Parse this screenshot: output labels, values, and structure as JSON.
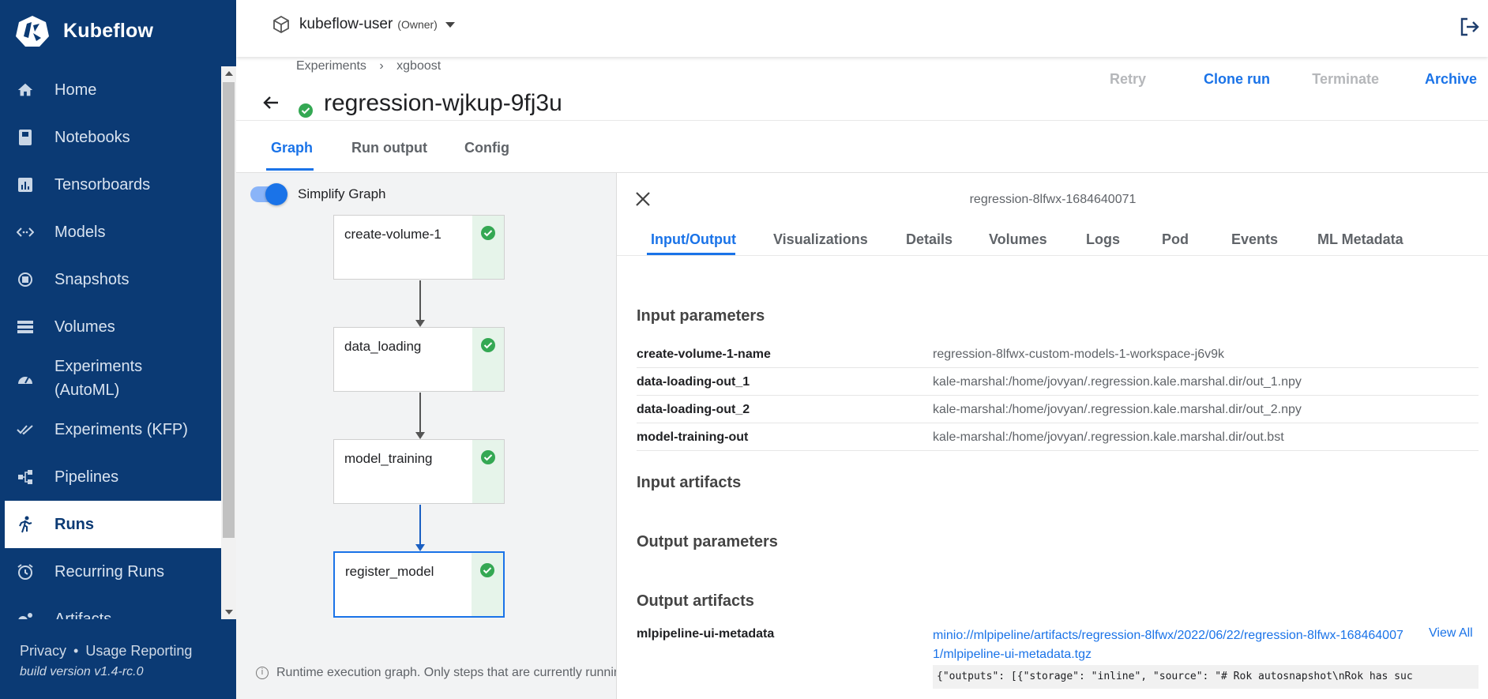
{
  "app": {
    "name": "Kubeflow"
  },
  "sidebar": {
    "items": [
      {
        "label": "Home",
        "icon": "home-icon"
      },
      {
        "label": "Notebooks",
        "icon": "notebook-icon"
      },
      {
        "label": "Tensorboards",
        "icon": "chart-icon"
      },
      {
        "label": "Models",
        "icon": "code-arrows-icon"
      },
      {
        "label": "Snapshots",
        "icon": "snapshot-icon"
      },
      {
        "label": "Volumes",
        "icon": "storage-icon"
      },
      {
        "label": "Experiments",
        "label2": "(AutoML)",
        "icon": "speed-icon"
      },
      {
        "label": "Experiments (KFP)",
        "icon": "done-all-icon"
      },
      {
        "label": "Pipelines",
        "icon": "pipeline-icon"
      },
      {
        "label": "Runs",
        "icon": "run-icon",
        "active": true
      },
      {
        "label": "Recurring Runs",
        "icon": "alarm-icon"
      },
      {
        "label": "Artifacts",
        "icon": "bubbles-icon"
      }
    ],
    "footer": {
      "privacy": "Privacy",
      "separator": "•",
      "usage": "Usage Reporting",
      "build": "build version v1.4-rc.0"
    }
  },
  "topbar": {
    "namespace": "kubeflow-user",
    "role": "(Owner)"
  },
  "breadcrumb": {
    "items": [
      "Experiments",
      "›",
      "xgboost"
    ]
  },
  "run": {
    "title": "regression-wjkup-9fj3u",
    "status": "succeeded"
  },
  "actions": {
    "retry": "Retry",
    "clone": "Clone run",
    "terminate": "Terminate",
    "archive": "Archive"
  },
  "tabs": {
    "graph": "Graph",
    "run_output": "Run output",
    "config": "Config"
  },
  "graph": {
    "simplify_label": "Simplify Graph",
    "simplify_on": true,
    "nodes": [
      "create-volume-1",
      "data_loading",
      "model_training",
      "register_model"
    ],
    "note": "Runtime execution graph. Only steps that are currently running"
  },
  "panel": {
    "title": "regression-8lfwx-1684640071",
    "tabs": [
      "Input/Output",
      "Visualizations",
      "Details",
      "Volumes",
      "Logs",
      "Pod",
      "Events",
      "ML Metadata"
    ],
    "input_parameters_title": "Input parameters",
    "input_parameters": [
      {
        "key": "create-volume-1-name",
        "value": "regression-8lfwx-custom-models-1-workspace-j6v9k"
      },
      {
        "key": "data-loading-out_1",
        "value": "kale-marshal:/home/jovyan/.regression.kale.marshal.dir/out_1.npy"
      },
      {
        "key": "data-loading-out_2",
        "value": "kale-marshal:/home/jovyan/.regression.kale.marshal.dir/out_2.npy"
      },
      {
        "key": "model-training-out",
        "value": "kale-marshal:/home/jovyan/.regression.kale.marshal.dir/out.bst"
      }
    ],
    "input_artifacts_title": "Input artifacts",
    "output_parameters_title": "Output parameters",
    "output_artifacts_title": "Output artifacts",
    "output_artifact": {
      "key": "mlpipeline-ui-metadata",
      "link_line1": "minio://mlpipeline/artifacts/regression-8lfwx/2022/06/22/regression-8lfwx-168464007",
      "link_line2": "1/mlpipeline-ui-metadata.tgz",
      "view_all": "View All",
      "preview": "{\"outputs\": [{\"storage\": \"inline\", \"source\": \"# Rok autosnapshot\\nRok has suc"
    }
  },
  "colors": {
    "sidebar_bg": "#0b3a74",
    "accent": "#1a73e8",
    "success": "#34a853"
  }
}
